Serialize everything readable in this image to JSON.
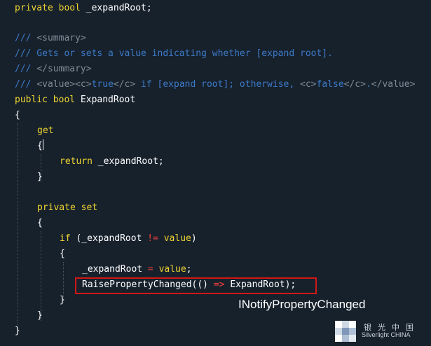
{
  "code": {
    "l1": {
      "kw": "private bool ",
      "id": "_expandRoot;"
    },
    "l2": "/// ",
    "l2tag": "<summary>",
    "l3": "/// Gets or sets a value indicating whether [expand root].",
    "l4": "/// ",
    "l4tag": "</summary>",
    "l5": {
      "p1": "/// ",
      "t1": "<value><c>",
      "p2": "true",
      "t2": "</c>",
      "p3": " if [expand root]; otherwise, ",
      "t3": "<c>",
      "p4": "false",
      "t4": "</c>",
      "p5": ".",
      "t5": "</value>"
    },
    "l6": {
      "kw": "public bool ",
      "id": "ExpandRoot"
    },
    "l7": "{",
    "l8": "get",
    "l9": "{",
    "l10": {
      "kw": "return ",
      "id": "_expandRoot;"
    },
    "l11": "}",
    "l12": "private set",
    "l13": "{",
    "l14": {
      "kw": "if ",
      "id1": "(_expandRoot ",
      "op": "!=",
      "kw2": " value",
      "id2": ")"
    },
    "l15": "{",
    "l16": {
      "id": "_expandRoot ",
      "op": "=",
      "kw": " value",
      "end": ";"
    },
    "l17": {
      "id": "RaisePropertyChanged(() ",
      "op": "=>",
      "id2": " ExpandRoot);"
    },
    "l18": "}",
    "l19": "}",
    "l20": "}"
  },
  "annotation": "INotifyPropertyChanged",
  "watermark": {
    "cn": "银光中国",
    "en": "Silverlight CHINA"
  },
  "colors": {
    "background": "#17212c",
    "keyword": "#eed431",
    "comment": "#3c7ac8",
    "xml_tag": "#7d8a96",
    "operator": "#ff3f3f",
    "highlight_box": "#d01717"
  }
}
